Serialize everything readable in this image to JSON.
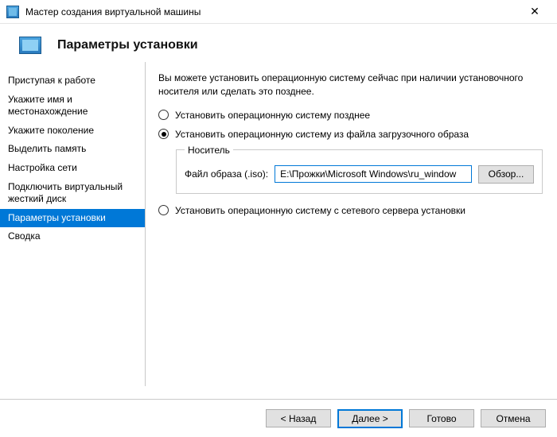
{
  "window": {
    "title": "Мастер создания виртуальной машины"
  },
  "header": {
    "title": "Параметры установки"
  },
  "sidebar": {
    "steps": [
      {
        "label": "Приступая к работе"
      },
      {
        "label": "Укажите имя и местонахождение"
      },
      {
        "label": "Укажите поколение"
      },
      {
        "label": "Выделить память"
      },
      {
        "label": "Настройка сети"
      },
      {
        "label": "Подключить виртуальный жесткий диск"
      },
      {
        "label": "Параметры установки"
      },
      {
        "label": "Сводка"
      }
    ],
    "active_index": 6
  },
  "content": {
    "intro": "Вы можете установить операционную систему сейчас при наличии установочного носителя или сделать это позднее.",
    "option_later": "Установить операционную систему позднее",
    "option_from_image": "Установить операционную систему из файла загрузочного образа",
    "option_from_network": "Установить операционную систему с сетевого сервера установки",
    "selected_option": "from_image",
    "media": {
      "legend": "Носитель",
      "iso_label": "Файл образа (.iso):",
      "iso_value": "E:\\Прожки\\Microsoft Windows\\ru_window",
      "browse": "Обзор..."
    }
  },
  "footer": {
    "back": "< Назад",
    "next": "Далее >",
    "finish": "Готово",
    "cancel": "Отмена"
  }
}
